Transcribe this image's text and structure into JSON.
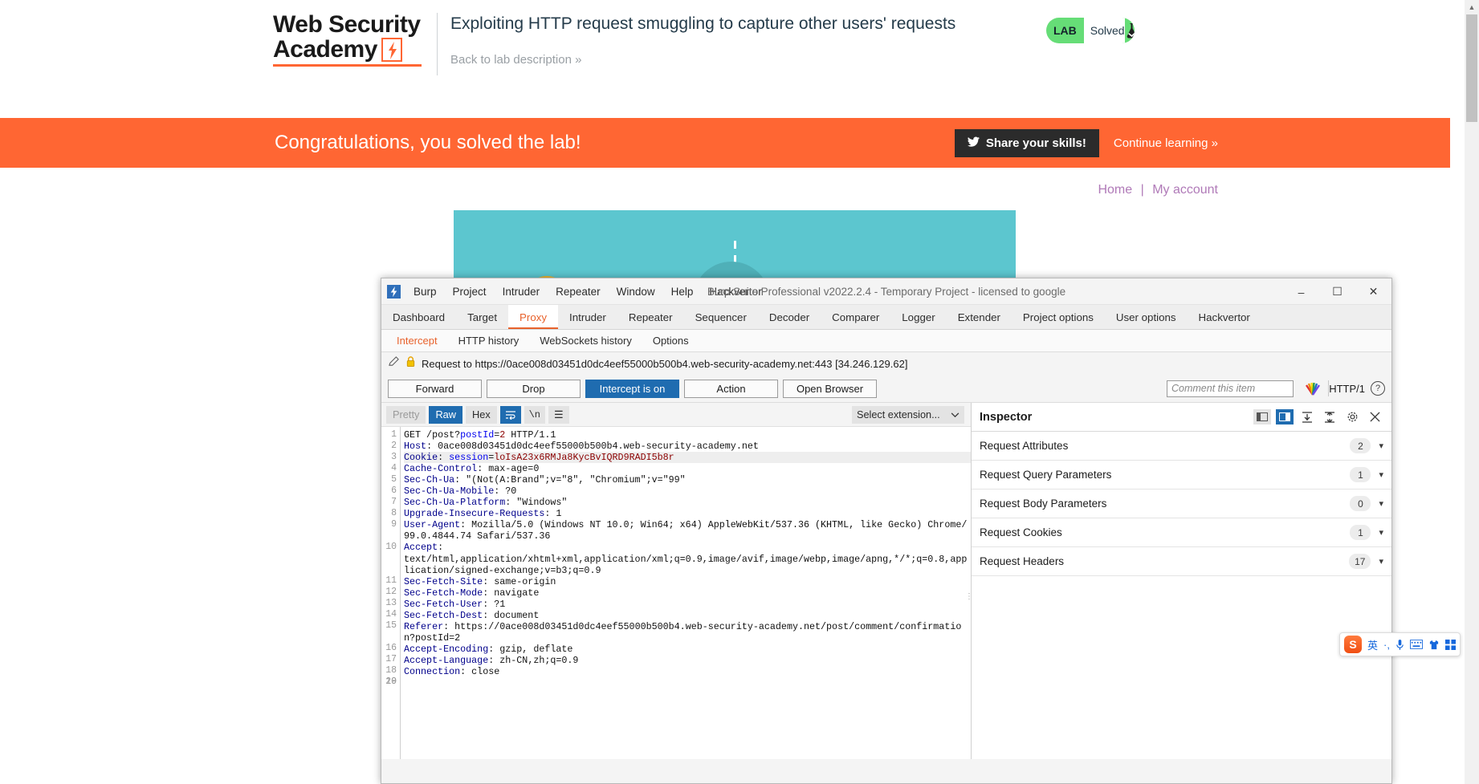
{
  "lab": {
    "logo_line1": "Web Security",
    "logo_line2": "Academy",
    "title": "Exploiting HTTP request smuggling to capture other users' requests",
    "back_link": "Back to lab description",
    "back_link_chevrons": "»",
    "badge": {
      "tag": "LAB",
      "status": "Solved",
      "icon": "flask-check-icon",
      "color": "#66dd77"
    },
    "banner": {
      "message": "Congratulations, you solved the lab!",
      "share_label": "Share your skills!",
      "share_icon": "twitter-icon",
      "continue_label": "Continue learning",
      "continue_chevrons": "»",
      "background": "#ff6633"
    },
    "account_nav": {
      "home": "Home",
      "separator": "|",
      "my_account": "My account"
    }
  },
  "burp": {
    "window_title": "Burp Suite Professional v2022.2.4 - Temporary Project - licensed to google",
    "menu": [
      "Burp",
      "Project",
      "Intruder",
      "Repeater",
      "Window",
      "Help",
      "Hackvertor"
    ],
    "window_buttons": {
      "minimize": "–",
      "maximize": "☐",
      "close": "✕"
    },
    "tabs": [
      {
        "label": "Dashboard",
        "active": false
      },
      {
        "label": "Target",
        "active": false
      },
      {
        "label": "Proxy",
        "active": true
      },
      {
        "label": "Intruder",
        "active": false
      },
      {
        "label": "Repeater",
        "active": false
      },
      {
        "label": "Sequencer",
        "active": false
      },
      {
        "label": "Decoder",
        "active": false
      },
      {
        "label": "Comparer",
        "active": false
      },
      {
        "label": "Logger",
        "active": false
      },
      {
        "label": "Extender",
        "active": false
      },
      {
        "label": "Project options",
        "active": false
      },
      {
        "label": "User options",
        "active": false
      },
      {
        "label": "Hackvertor",
        "active": false
      }
    ],
    "subtabs": [
      {
        "label": "Intercept",
        "active": true
      },
      {
        "label": "HTTP history",
        "active": false
      },
      {
        "label": "WebSockets history",
        "active": false
      },
      {
        "label": "Options",
        "active": false
      }
    ],
    "request_bar": {
      "edit_icon": "pencil-icon",
      "lock_icon": "lock-icon",
      "text": "Request to https://0ace008d03451d0dc4eef55000b500b4.web-security-academy.net:443  [34.246.129.62]"
    },
    "actions": [
      {
        "label": "Forward",
        "state": "normal"
      },
      {
        "label": "Drop",
        "state": "normal"
      },
      {
        "label": "Intercept is on",
        "state": "active"
      },
      {
        "label": "Action",
        "state": "normal"
      },
      {
        "label": "Open Browser",
        "state": "normal"
      }
    ],
    "comment_placeholder": "Comment this item",
    "rainbow_icon": "hackvertor-rainbow-icon",
    "http_version": "HTTP/1",
    "help_icon": "question-mark-icon",
    "format_buttons": [
      {
        "label": "Pretty",
        "state": "inactive"
      },
      {
        "label": "Raw",
        "state": "selected"
      },
      {
        "label": "Hex",
        "state": "normal"
      }
    ],
    "format_icons": [
      {
        "name": "word-wrap-icon",
        "state": "selected",
        "glyph": "↵"
      },
      {
        "name": "newline-icon",
        "state": "normal",
        "glyph": "\\n"
      },
      {
        "name": "hamburger-menu-icon",
        "state": "normal",
        "glyph": "☰"
      }
    ],
    "extension_select": "Select extension...",
    "extension_chevron": "⌄",
    "request": {
      "line_numbers": [
        "1",
        "2",
        "3",
        "4",
        "5",
        "6",
        "7",
        "8",
        "9",
        "10",
        "11",
        "12",
        "13",
        "14",
        "15",
        "16",
        "17",
        "18",
        "19",
        "20"
      ],
      "lines": [
        {
          "n": 1,
          "parts": [
            [
              "plain",
              "GET /post?"
            ],
            [
              "v",
              "postId"
            ],
            [
              "plain",
              "="
            ],
            [
              "r",
              "2"
            ],
            [
              "plain",
              " HTTP/1.1"
            ]
          ]
        },
        {
          "n": 2,
          "parts": [
            [
              "k",
              "Host"
            ],
            [
              "plain",
              ": 0ace008d03451d0dc4eef55000b500b4.web-security-academy.net"
            ]
          ]
        },
        {
          "n": 3,
          "highlight": true,
          "parts": [
            [
              "k",
              "Cookie"
            ],
            [
              "plain",
              ": "
            ],
            [
              "v",
              "session"
            ],
            [
              "plain",
              "="
            ],
            [
              "r",
              "loIsA23x6RMJa8KycBvIQRD9RADI5b8r"
            ]
          ]
        },
        {
          "n": 4,
          "parts": [
            [
              "k",
              "Cache-Control"
            ],
            [
              "plain",
              ": max-age=0"
            ]
          ]
        },
        {
          "n": 5,
          "parts": [
            [
              "k",
              "Sec-Ch-Ua"
            ],
            [
              "plain",
              ": \"(Not(A:Brand\";v=\"8\", \"Chromium\";v=\"99\""
            ]
          ]
        },
        {
          "n": 6,
          "parts": [
            [
              "k",
              "Sec-Ch-Ua-Mobile"
            ],
            [
              "plain",
              ": ?0"
            ]
          ]
        },
        {
          "n": 7,
          "parts": [
            [
              "k",
              "Sec-Ch-Ua-Platform"
            ],
            [
              "plain",
              ": \"Windows\""
            ]
          ]
        },
        {
          "n": 8,
          "parts": [
            [
              "k",
              "Upgrade-Insecure-Requests"
            ],
            [
              "plain",
              ": 1"
            ]
          ]
        },
        {
          "n": 9,
          "parts": [
            [
              "k",
              "User-Agent"
            ],
            [
              "plain",
              ": Mozilla/5.0 (Windows NT 10.0; Win64; x64) AppleWebKit/537.36 (KHTML, like Gecko) Chrome/99.0.4844.74 Safari/537.36"
            ]
          ]
        },
        {
          "n": 10,
          "parts": [
            [
              "k",
              "Accept"
            ],
            [
              "plain",
              ":\ntext/html,application/xhtml+xml,application/xml;q=0.9,image/avif,image/webp,image/apng,*/*;q=0.8,application/signed-exchange;v=b3;q=0.9"
            ]
          ]
        },
        {
          "n": 11,
          "parts": [
            [
              "k",
              "Sec-Fetch-Site"
            ],
            [
              "plain",
              ": same-origin"
            ]
          ]
        },
        {
          "n": 12,
          "parts": [
            [
              "k",
              "Sec-Fetch-Mode"
            ],
            [
              "plain",
              ": navigate"
            ]
          ]
        },
        {
          "n": 13,
          "parts": [
            [
              "k",
              "Sec-Fetch-User"
            ],
            [
              "plain",
              ": ?1"
            ]
          ]
        },
        {
          "n": 14,
          "parts": [
            [
              "k",
              "Sec-Fetch-Dest"
            ],
            [
              "plain",
              ": document"
            ]
          ]
        },
        {
          "n": 15,
          "parts": [
            [
              "k",
              "Referer"
            ],
            [
              "plain",
              ": https://0ace008d03451d0dc4eef55000b500b4.web-security-academy.net/post/comment/confirmation?postId=2"
            ]
          ]
        },
        {
          "n": 16,
          "parts": [
            [
              "k",
              "Accept-Encoding"
            ],
            [
              "plain",
              ": gzip, deflate"
            ]
          ]
        },
        {
          "n": 17,
          "parts": [
            [
              "k",
              "Accept-Language"
            ],
            [
              "plain",
              ": zh-CN,zh;q=0.9"
            ]
          ]
        },
        {
          "n": 18,
          "parts": [
            [
              "k",
              "Connection"
            ],
            [
              "plain",
              ": close"
            ]
          ]
        },
        {
          "n": 19,
          "parts": [
            [
              "plain",
              ""
            ]
          ]
        },
        {
          "n": 20,
          "parts": [
            [
              "plain",
              ""
            ]
          ]
        }
      ]
    },
    "inspector": {
      "title": "Inspector",
      "layout_icons": [
        {
          "name": "layout-left-icon",
          "state": "normal"
        },
        {
          "name": "layout-right-icon",
          "state": "selected"
        }
      ],
      "tool_icons": [
        {
          "name": "expand-all-icon",
          "glyph": "⧉"
        },
        {
          "name": "collapse-all-icon",
          "glyph": "≡"
        },
        {
          "name": "gear-icon",
          "glyph": "⚙"
        },
        {
          "name": "close-icon",
          "glyph": "✕"
        }
      ],
      "sections": [
        {
          "label": "Request Attributes",
          "count": "2"
        },
        {
          "label": "Request Query Parameters",
          "count": "1"
        },
        {
          "label": "Request Body Parameters",
          "count": "0"
        },
        {
          "label": "Request Cookies",
          "count": "1"
        },
        {
          "label": "Request Headers",
          "count": "17"
        }
      ]
    }
  },
  "ime": {
    "brand": "S",
    "items": [
      {
        "name": "language-mode-icon",
        "glyph": "英"
      },
      {
        "name": "punctuation-icon",
        "glyph": "·,"
      },
      {
        "name": "microphone-icon",
        "glyph": "⬤"
      },
      {
        "name": "soft-keyboard-icon",
        "glyph": "⌨"
      },
      {
        "name": "skin-icon",
        "glyph": "▼"
      },
      {
        "name": "toolbox-icon",
        "glyph": "☷"
      }
    ]
  }
}
